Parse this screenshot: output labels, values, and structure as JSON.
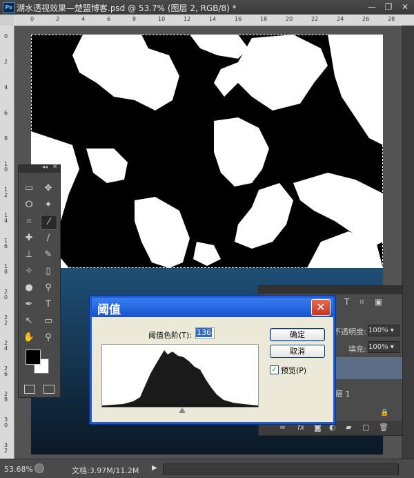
{
  "window": {
    "app_badge": "Ps",
    "title": "湖水透视效果—楚盟博客.psd @ 53.7% (图层 2, RGB/8) *",
    "minimize": "—",
    "restore": "❐",
    "close": "✕"
  },
  "ruler_top_ticks": [
    "0",
    "2",
    "4",
    "6",
    "8",
    "10",
    "12",
    "14",
    "16",
    "18",
    "20",
    "22",
    "24",
    "26",
    "28"
  ],
  "ruler_left_ticks": [
    "0",
    "2",
    "4",
    "6",
    "8",
    "1\n0",
    "1\n2",
    "1\n4",
    "1\n6",
    "1\n8",
    "2\n0",
    "2\n2",
    "2\n4",
    "2\n6",
    "2\n8",
    "3\n0",
    "3\n2"
  ],
  "tools": {
    "collapse": "◂◂",
    "close": "✕",
    "items": [
      "▭",
      "✥",
      "ⵔ",
      "✦",
      "⌗",
      "⁄",
      "✚",
      "∕",
      "⊥",
      "✎",
      "✧",
      "▯",
      "●",
      "⚲",
      "✒",
      "T",
      "↖",
      "▭",
      "✋",
      "⚲"
    ]
  },
  "layers_panel": {
    "opacity_label": "不透明度:",
    "opacity_value": "100%",
    "fill_label": "填充:",
    "fill_value": "100%",
    "layer_name": "图层 1"
  },
  "dialog": {
    "title": "阈值",
    "close": "✕",
    "threshold_label": "阈值色阶(T):",
    "threshold_value": "136",
    "ok_label": "确定",
    "cancel_label": "取消",
    "preview_label": "预览(P)",
    "preview_checked": "✓"
  },
  "status": {
    "zoom": "53.68%",
    "doc_size": "文档:3.97M/11.2M",
    "nav_arrow": "▶"
  },
  "colors": {
    "dialog_border": "#1d5bd6",
    "close_button": "#c2371c",
    "canvas_lower": "#1f4f76"
  }
}
